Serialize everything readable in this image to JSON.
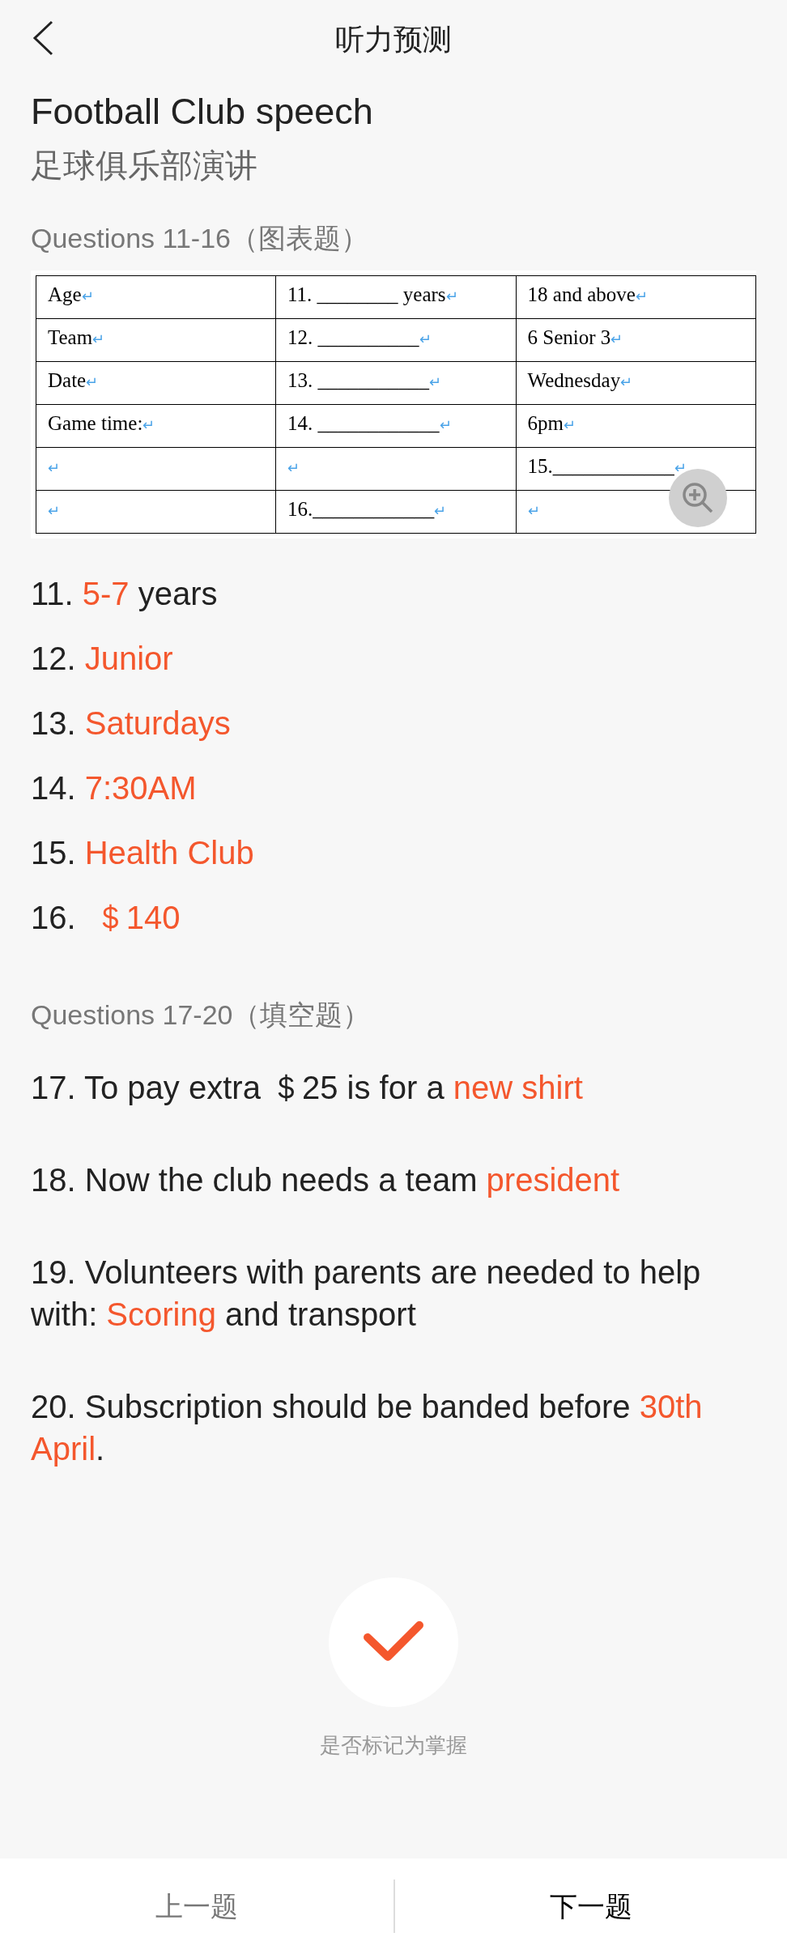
{
  "header": {
    "title": "听力预测"
  },
  "title": "Football Club speech",
  "subtitle": "足球俱乐部演讲",
  "section_1": {
    "heading": "Questions 11-16（图表题）",
    "table": {
      "rows": [
        [
          {
            "text": "Age",
            "mark": "↵"
          },
          {
            "text": "11. ________ years",
            "mark": "↵"
          },
          {
            "text": "18 and above",
            "mark": "↵"
          }
        ],
        [
          {
            "text": "Team",
            "mark": "↵"
          },
          {
            "text": "12. __________",
            "mark": "↵"
          },
          {
            "text": "6 Senior 3",
            "mark": "↵"
          }
        ],
        [
          {
            "text": "Date",
            "mark": "↵"
          },
          {
            "text": "13. ___________",
            "mark": "↵"
          },
          {
            "text": "Wednesday",
            "mark": "↵"
          }
        ],
        [
          {
            "text": "Game time:",
            "mark": "↵"
          },
          {
            "text": "14. ____________",
            "mark": "↵"
          },
          {
            "text": "6pm",
            "mark": "↵"
          }
        ],
        [
          {
            "mark": "↵"
          },
          {
            "mark": "↵"
          },
          {
            "text": "15.____________",
            "mark": "↵"
          }
        ],
        [
          {
            "mark": "↵"
          },
          {
            "text": "16.____________",
            "mark": "↵"
          },
          {
            "mark": "↵"
          }
        ]
      ]
    },
    "answers": [
      {
        "number": "11.",
        "parts": [
          {
            "kind": "answer",
            "text": "5-7"
          },
          {
            "kind": "plain",
            "text": " years"
          }
        ]
      },
      {
        "number": "12.",
        "parts": [
          {
            "kind": "answer",
            "text": "Junior"
          }
        ]
      },
      {
        "number": "13.",
        "parts": [
          {
            "kind": "answer",
            "text": "Saturdays"
          }
        ]
      },
      {
        "number": "14.",
        "parts": [
          {
            "kind": "answer",
            "text": "7:30AM"
          }
        ]
      },
      {
        "number": "15.",
        "parts": [
          {
            "kind": "answer",
            "text": "Health Club"
          }
        ]
      },
      {
        "number": "16.",
        "parts": [
          {
            "kind": "answer",
            "text": " ＄140"
          }
        ]
      }
    ]
  },
  "section_2": {
    "heading": "Questions 17-20（填空题）",
    "answers": [
      {
        "number": "17.",
        "parts": [
          {
            "kind": "plain",
            "text": "To pay extra ＄25 is for a "
          },
          {
            "kind": "answer",
            "text": "new shirt"
          }
        ]
      },
      {
        "number": "18.",
        "parts": [
          {
            "kind": "plain",
            "text": "Now the club needs a team "
          },
          {
            "kind": "answer",
            "text": "president"
          }
        ]
      },
      {
        "number": "19.",
        "parts": [
          {
            "kind": "plain",
            "text": "Volunteers with parents are needed to help with: "
          },
          {
            "kind": "answer",
            "text": "Scoring"
          },
          {
            "kind": "plain",
            "text": " and transport"
          }
        ]
      },
      {
        "number": "20.",
        "parts": [
          {
            "kind": "plain",
            "text": "Subscription should be banded before "
          },
          {
            "kind": "answer",
            "text": "30th April"
          },
          {
            "kind": "plain",
            "text": "."
          }
        ]
      }
    ]
  },
  "mastered": {
    "label": "是否标记为掌握",
    "checked": false
  },
  "footer": {
    "buttons": [
      {
        "label": "上一题",
        "selected": false
      },
      {
        "label": "下一题",
        "selected": true
      }
    ]
  }
}
